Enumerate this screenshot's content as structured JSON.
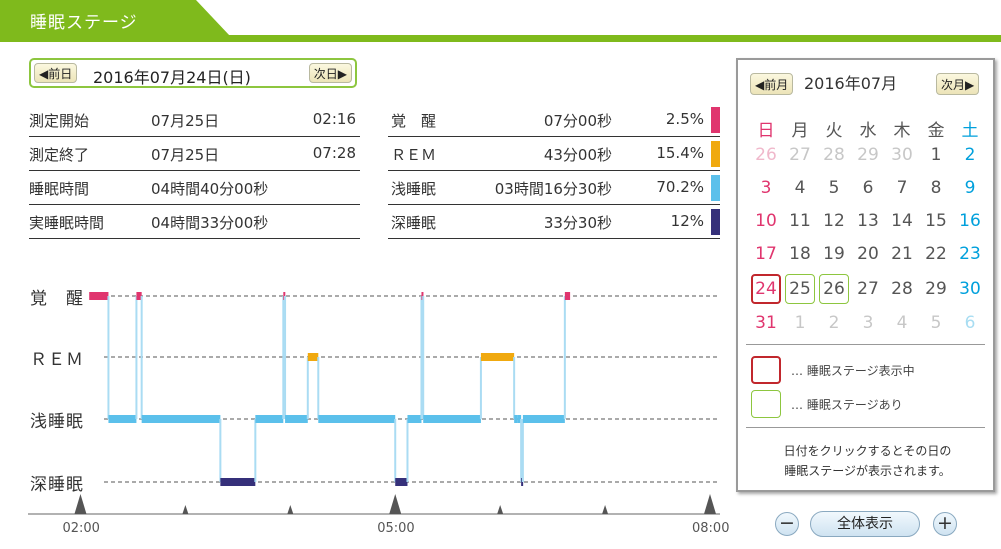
{
  "header": {
    "title": "睡眠ステージ"
  },
  "date_nav": {
    "prev_label": "前日",
    "next_label": "次日",
    "current_date": "2016年07月24日(日)"
  },
  "summary": {
    "left": [
      {
        "label": "測定開始",
        "value": "07月25日",
        "extra": "02:16"
      },
      {
        "label": "測定終了",
        "value": "07月25日",
        "extra": "07:28"
      },
      {
        "label": "睡眠時間",
        "value": "04時間40分00秒",
        "extra": ""
      },
      {
        "label": "実睡眠時間",
        "value": "04時間33分00秒",
        "extra": ""
      }
    ],
    "right": [
      {
        "label": "覚　醒",
        "duration": "07分00秒",
        "percent": "2.5%",
        "color": "#e0356e"
      },
      {
        "label": "ＲＥＭ",
        "duration": "43分00秒",
        "percent": "15.4%",
        "color": "#f0a90f"
      },
      {
        "label": "浅睡眠",
        "duration": "03時間16分30秒",
        "percent": "70.2%",
        "color": "#5bc0eb"
      },
      {
        "label": "深睡眠",
        "duration": "33分30秒",
        "percent": "12%",
        "color": "#35307a"
      }
    ]
  },
  "chart": {
    "stage_labels": [
      "覚　醒",
      "ＲＥＭ",
      "浅睡眠",
      "深睡眠"
    ],
    "x_tick_labels": [
      "02:00",
      "05:00",
      "08:00"
    ]
  },
  "chart_data": {
    "type": "line",
    "xlabel": "",
    "ylabel": "",
    "x_range": [
      "01:30",
      "08:00"
    ],
    "y_categories": [
      "覚　醒",
      "ＲＥＭ",
      "浅睡眠",
      "深睡眠"
    ],
    "step_colors": {
      "覚　醒": "#e0356e",
      "ＲＥＭ": "#f0a90f",
      "浅睡眠": "#5bc0eb",
      "深睡眠": "#35307a"
    },
    "segments": [
      {
        "start": "02:05",
        "end": "02:16",
        "stage": "覚　醒"
      },
      {
        "start": "02:16",
        "end": "02:32",
        "stage": "浅睡眠"
      },
      {
        "start": "02:32",
        "end": "02:35",
        "stage": "覚　醒"
      },
      {
        "start": "02:35",
        "end": "03:20",
        "stage": "浅睡眠"
      },
      {
        "start": "03:20",
        "end": "03:40",
        "stage": "深睡眠"
      },
      {
        "start": "03:40",
        "end": "03:56",
        "stage": "浅睡眠"
      },
      {
        "start": "03:56",
        "end": "03:57",
        "stage": "覚　醒"
      },
      {
        "start": "03:57",
        "end": "04:10",
        "stage": "浅睡眠"
      },
      {
        "start": "04:10",
        "end": "04:16",
        "stage": "ＲＥＭ"
      },
      {
        "start": "04:16",
        "end": "05:00",
        "stage": "浅睡眠"
      },
      {
        "start": "05:00",
        "end": "05:07",
        "stage": "深睡眠"
      },
      {
        "start": "05:07",
        "end": "05:15",
        "stage": "浅睡眠"
      },
      {
        "start": "05:15",
        "end": "05:16",
        "stage": "覚　醒"
      },
      {
        "start": "05:16",
        "end": "05:49",
        "stage": "浅睡眠"
      },
      {
        "start": "05:49",
        "end": "06:08",
        "stage": "ＲＥＭ"
      },
      {
        "start": "06:08",
        "end": "06:10",
        "stage": "浅睡眠"
      },
      {
        "start": "06:10",
        "end": "06:12",
        "stage": "浅睡眠"
      },
      {
        "start": "06:12",
        "end": "06:13",
        "stage": "深睡眠"
      },
      {
        "start": "06:13",
        "end": "06:37",
        "stage": "浅睡眠"
      },
      {
        "start": "06:37",
        "end": "06:40",
        "stage": "覚　醒"
      }
    ]
  },
  "calendar": {
    "prev_label": "前月",
    "next_label": "次月",
    "month_title": "2016年07月",
    "weekdays": [
      "日",
      "月",
      "火",
      "水",
      "木",
      "金",
      "土"
    ],
    "weeks": [
      [
        "26",
        "27",
        "28",
        "29",
        "30",
        "1",
        "2"
      ],
      [
        "3",
        "4",
        "5",
        "6",
        "7",
        "8",
        "9"
      ],
      [
        "10",
        "11",
        "12",
        "13",
        "14",
        "15",
        "16"
      ],
      [
        "17",
        "18",
        "19",
        "20",
        "21",
        "22",
        "23"
      ],
      [
        "24",
        "25",
        "26",
        "27",
        "28",
        "29",
        "30"
      ],
      [
        "31",
        "1",
        "2",
        "3",
        "4",
        "5",
        "6"
      ]
    ],
    "selected_day": "24",
    "days_with_data": [
      "25",
      "26"
    ],
    "legend": [
      {
        "text": "… 睡眠ステージ表示中",
        "color": "#c1272d"
      },
      {
        "text": "… 睡眠ステージあり",
        "color": "#8dc63f"
      }
    ],
    "note_line1": "日付をクリックするとその日の",
    "note_line2": "睡眠ステージが表示されます。"
  },
  "zoom": {
    "minus_label": "−",
    "all_label": "全体表示",
    "plus_label": "+"
  },
  "colors": {
    "accent_green": "#7fba1c",
    "sunday": "#e0356e",
    "saturday": "#00a0dc"
  }
}
